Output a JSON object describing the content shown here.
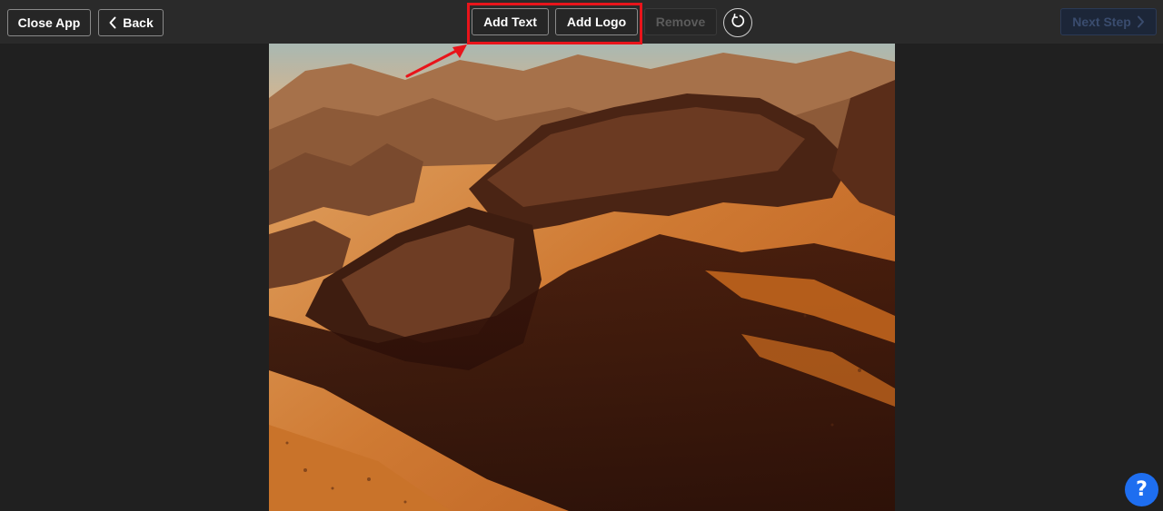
{
  "toolbar": {
    "close_label": "Close App",
    "back_label": "Back",
    "add_text_label": "Add Text",
    "add_logo_label": "Add Logo",
    "remove_label": "Remove",
    "next_label": "Next Step"
  },
  "help": {
    "label": "?"
  },
  "colors": {
    "background": "#202020",
    "toolbar": "#2a2a2a",
    "highlight": "#e8141b",
    "help_button": "#1e6ef0"
  },
  "canvas": {
    "content": "aerial desert rock formations photo"
  },
  "icons": [
    "chevron-left-icon",
    "refresh-icon",
    "chevron-right-icon",
    "question-icon"
  ]
}
